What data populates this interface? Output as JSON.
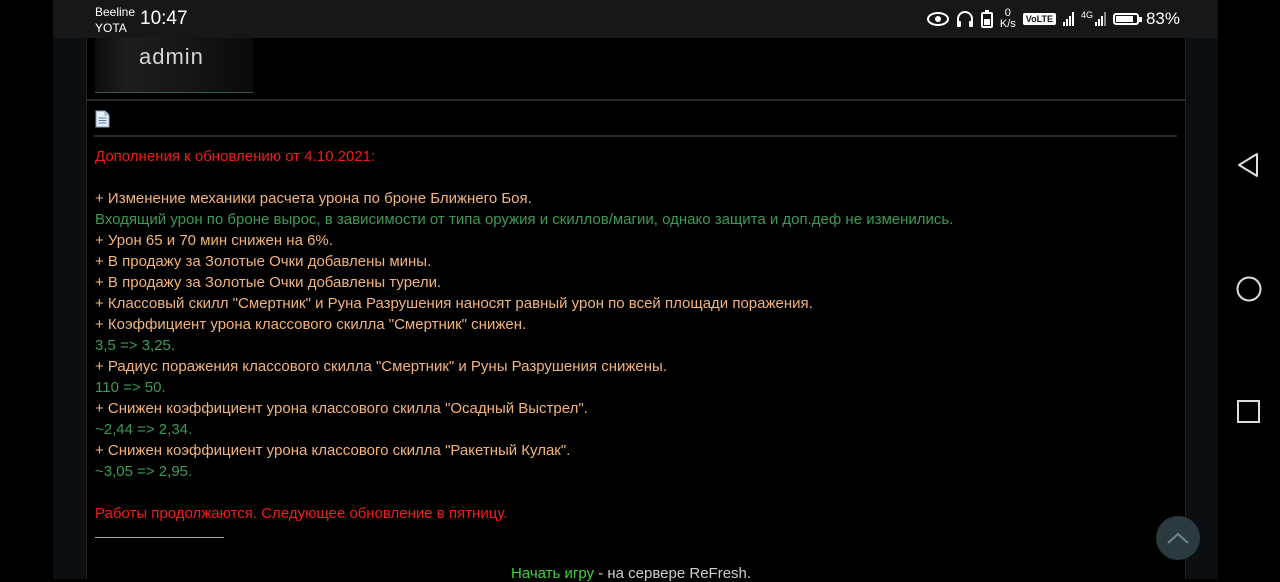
{
  "status_bar": {
    "carrier_line1": "Beeline",
    "carrier_line2": "YOTA",
    "time": "10:47",
    "net_speed_value": "0",
    "net_speed_unit": "K/s",
    "volte": "VoLTE",
    "network_type": "4G",
    "battery": "83%",
    "battery_level": 0.83
  },
  "post": {
    "avatar_name": "admin",
    "lines": [
      {
        "text": "Дополнения к обновлению от 4.10.2021:",
        "style": "red"
      },
      {
        "text": "",
        "style": "blank"
      },
      {
        "text": "+ Изменение механики расчета урона по броне Ближнего Боя.",
        "style": "orange"
      },
      {
        "text": "Входящий урон по броне вырос, в зависимости от типа оружия и скиллов/магии, однако защита и доп.деф не изменились.",
        "style": "green"
      },
      {
        "text": "+ Урон 65 и 70 мин снижен на 6%.",
        "style": "orange"
      },
      {
        "text": "+ В продажу за Золотые Очки добавлены мины.",
        "style": "orange"
      },
      {
        "text": "+ В продажу за Золотые Очки добавлены турели.",
        "style": "orange"
      },
      {
        "text": "+ Классовый скилл \"Смертник\" и Руна Разрушения наносят равный урон по всей площади поражения.",
        "style": "orange"
      },
      {
        "text": "+ Коэффициент урона классового скилла \"Смертник\" снижен.",
        "style": "orange"
      },
      {
        "text": "3,5 => 3,25.",
        "style": "green"
      },
      {
        "text": "+ Радиус поражения классового скилла \"Смертник\" и Руны Разрушения снижены.",
        "style": "orange"
      },
      {
        "text": "110 => 50.",
        "style": "green"
      },
      {
        "text": "+ Снижен коэффициент урона классового скилла \"Осадный Выстрел\".",
        "style": "orange"
      },
      {
        "text": "~2,44 => 2,34.",
        "style": "green"
      },
      {
        "text": "+ Снижен коэффициент урона классового скилла \"Ракетный Кулак\".",
        "style": "orange"
      },
      {
        "text": "~3,05 => 2,95.",
        "style": "green"
      },
      {
        "text": "",
        "style": "blank"
      },
      {
        "text": "Работы продолжаются. Следующее обновление в пятницу.",
        "style": "red"
      }
    ]
  },
  "footer": {
    "link": "Начать игру",
    "text": " - на сервере ReFresh."
  },
  "colors": {
    "red": "#f01c1c",
    "orange": "#f2b47a",
    "green": "#3c9a54",
    "link_green": "#3cd23c"
  },
  "icons": {
    "doc": "document-icon",
    "scroll_top": "chevron-up-icon",
    "nav_back": "back-triangle-icon",
    "nav_home": "home-circle-icon",
    "nav_recent": "recent-square-icon"
  }
}
